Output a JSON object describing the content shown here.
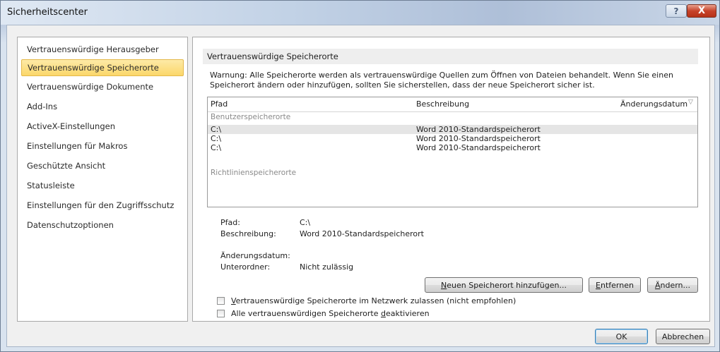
{
  "window": {
    "title": "Sicherheitscenter",
    "help_label": "?",
    "close_label": "X"
  },
  "nav": {
    "items": [
      {
        "label": "Vertrauenswürdige Herausgeber"
      },
      {
        "label": "Vertrauenswürdige Speicherorte",
        "selected": true
      },
      {
        "label": "Vertrauenswürdige Dokumente"
      },
      {
        "label": "Add-Ins"
      },
      {
        "label": "ActiveX-Einstellungen"
      },
      {
        "label": "Einstellungen für Makros"
      },
      {
        "label": "Geschützte Ansicht"
      },
      {
        "label": "Statusleiste"
      },
      {
        "label": "Einstellungen für den Zugriffsschutz"
      },
      {
        "label": "Datenschutzoptionen"
      }
    ]
  },
  "content": {
    "section_title": "Vertrauenswürdige Speicherorte",
    "warning_line1": "Warnung: Alle Speicherorte werden als vertrauenswürdige Quellen zum Öffnen von Dateien behandelt. Wenn Sie einen",
    "warning_line2": "Speicherort ändern oder hinzufügen, sollten Sie sicherstellen, dass der neue Speicherort sicher ist.",
    "table": {
      "columns": [
        "Pfad",
        "Beschreibung",
        "Änderungsdatum"
      ],
      "group_user": "Benutzerspeicherorte",
      "group_policy": "Richtlinienspeicherorte",
      "rows": [
        {
          "path": "C:\\",
          "description": "Word 2010-Standardspeicherort",
          "selected": true
        },
        {
          "path": "C:\\",
          "description": "Word 2010-Standardspeicherort"
        },
        {
          "path": "C:\\",
          "description": "Word 2010-Standardspeicherort"
        }
      ]
    },
    "details": {
      "path_label": "Pfad:",
      "path_value": "C:\\",
      "desc_label": "Beschreibung:",
      "desc_value": "Word 2010-Standardspeicherort",
      "date_label": "Änderungsdatum:",
      "subfolder_label": "Unterordner:",
      "subfolder_value": "Nicht zulässig"
    },
    "buttons": {
      "add_accel": "N",
      "add_rest": "euen Speicherort hinzufügen...",
      "remove_accel": "E",
      "remove_rest": "ntfernen",
      "change_accel": "Ä",
      "change_rest": "ndern..."
    },
    "checkboxes": {
      "network_accel": "V",
      "network_rest": "ertrauenswürdige Speicherorte im Netzwerk zulassen (nicht empfohlen)",
      "network_checked": false,
      "disable_prefix": "Alle vertrauenswürdigen Speicherorte ",
      "disable_accel": "d",
      "disable_rest": "eaktivieren",
      "disable_checked": false
    }
  },
  "footer": {
    "ok_label": "OK",
    "cancel_label": "Abbrechen"
  }
}
